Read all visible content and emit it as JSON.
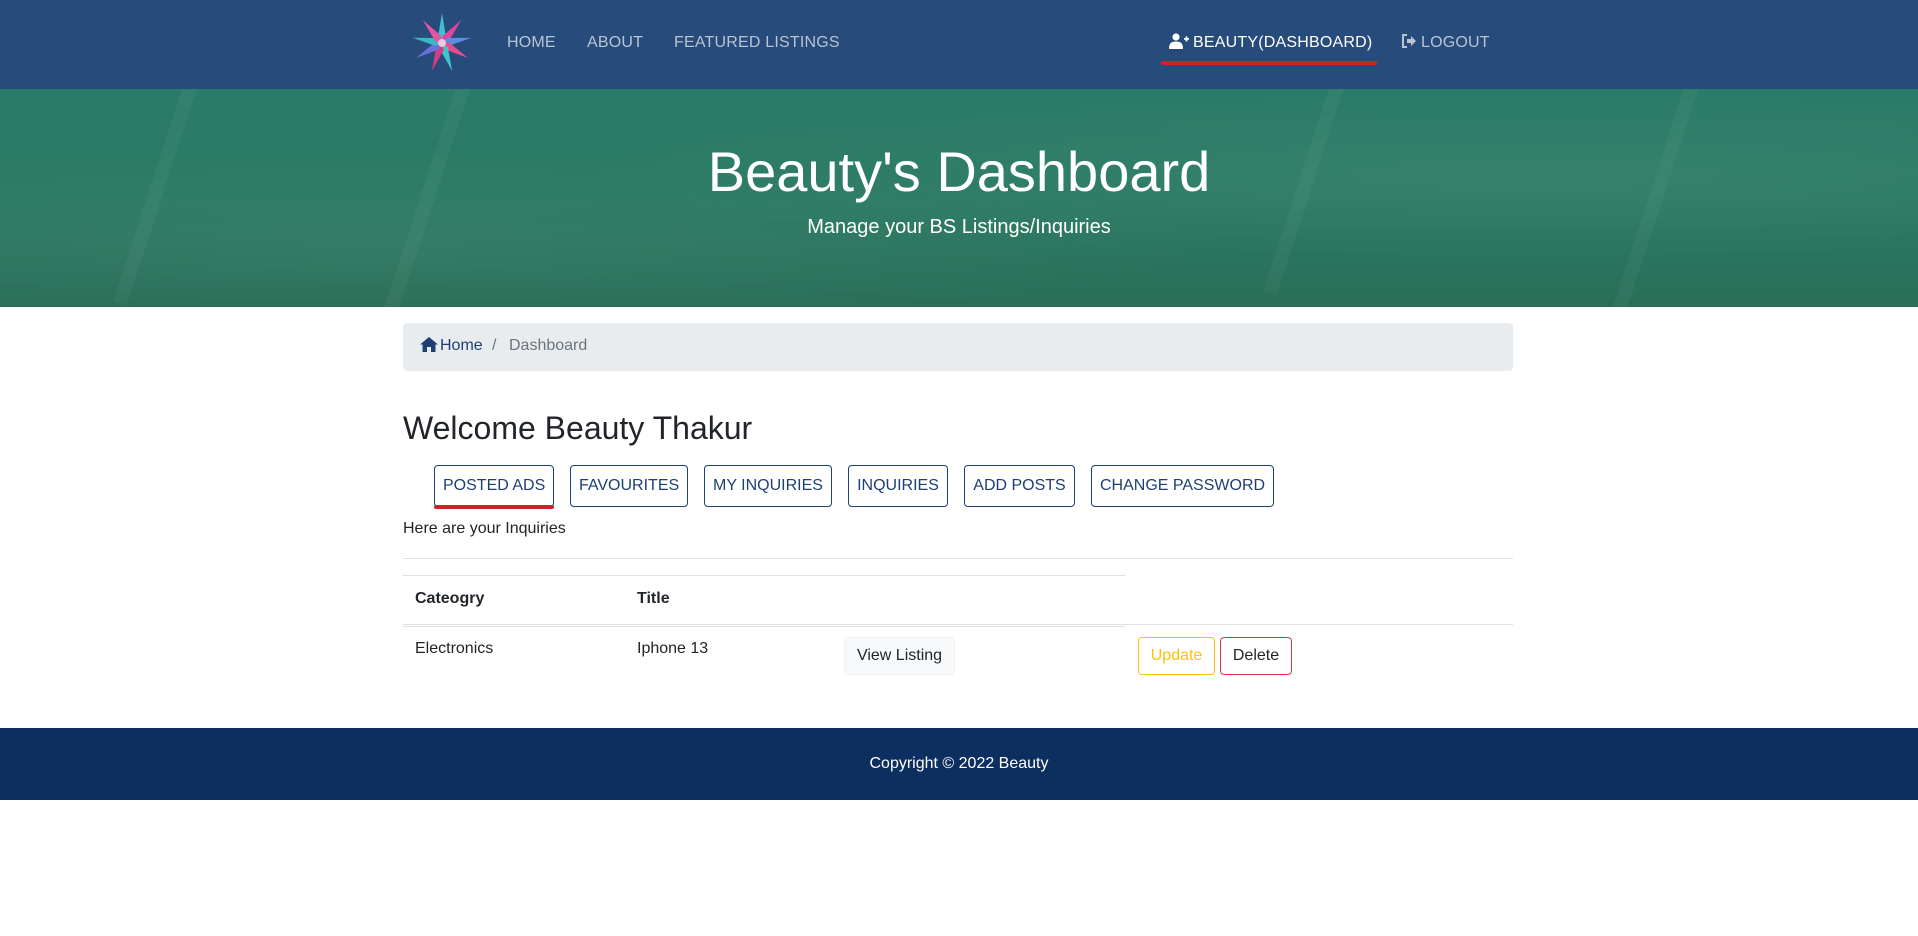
{
  "colors": {
    "navbar_bg": "#274b7a",
    "accent_red": "#d0202a",
    "hero_green": "#2b7a63",
    "brand_dark_blue": "#1e3f73",
    "footer_bg": "#0c2f5f",
    "warning": "#ffc107",
    "danger": "#dc3545"
  },
  "navbar": {
    "logo_icon": "flower-star-logo",
    "links": [
      "HOME",
      "ABOUT",
      "FEATURED LISTINGS"
    ],
    "dashboard_label": "BEAUTY(DASHBOARD)",
    "dashboard_icon": "user-plus-icon",
    "logout_label": "LOGOUT",
    "logout_icon": "sign-out-icon"
  },
  "hero": {
    "title": "Beauty's Dashboard",
    "subtitle": "Manage your BS Listings/Inquiries"
  },
  "breadcrumb": {
    "home_icon": "home-icon",
    "home": "Home",
    "separator": "/",
    "current": "Dashboard"
  },
  "welcome": "Welcome Beauty Thakur",
  "tabs": [
    "POSTED ADS",
    "FAVOURITES",
    "MY INQUIRIES",
    "INQUIRIES",
    "ADD POSTS",
    "CHANGE PASSWORD"
  ],
  "active_tab": "POSTED ADS",
  "info_text": "Here are your Inquiries",
  "table": {
    "headers": [
      "Cateogry",
      "Title"
    ],
    "rows": [
      {
        "category": "Electronics",
        "title": "Iphone 13",
        "view_label": "View Listing",
        "update_label": "Update",
        "delete_label": "Delete"
      }
    ]
  },
  "footer": {
    "copyright": "Copyright © 2022 Beauty"
  }
}
